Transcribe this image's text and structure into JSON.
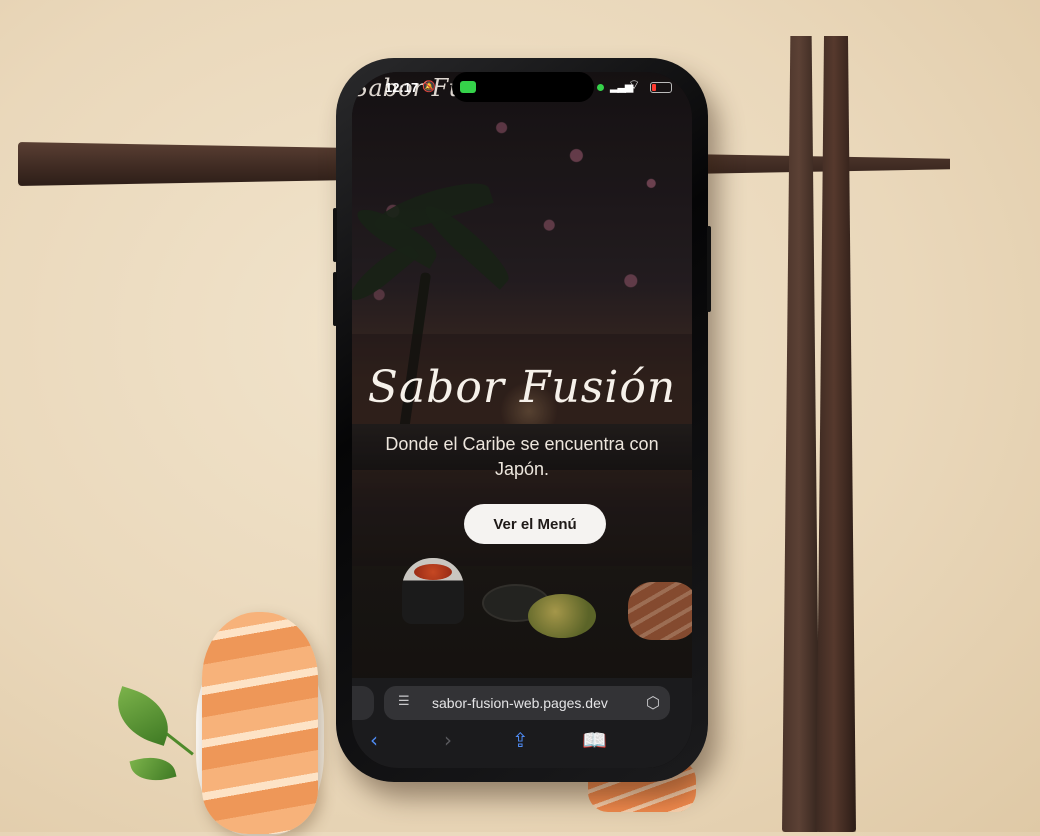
{
  "status_bar": {
    "time": "12:17",
    "icons": [
      "silent-bell-icon",
      "facetime-icon",
      "mic-indicator-icon",
      "signal-icon",
      "wifi-icon",
      "battery-icon"
    ]
  },
  "hero": {
    "top_logo": "Sabor Fusión",
    "title": "Sabor Fusión",
    "subtitle": "Donde el Caribe se encuentra con Japón.",
    "cta_label": "Ver el Menú"
  },
  "browser": {
    "url": "sabor-fusion-web.pages.dev",
    "toolbar": [
      "back-icon",
      "forward-icon",
      "share-icon",
      "bookmarks-icon"
    ]
  },
  "colors": {
    "title": "#f6f1ea",
    "cta_background": "#f5f3f1",
    "browser_accent": "#4f8cf5",
    "facetime_green": "#35d24a",
    "battery_low": "#ff3b30"
  }
}
